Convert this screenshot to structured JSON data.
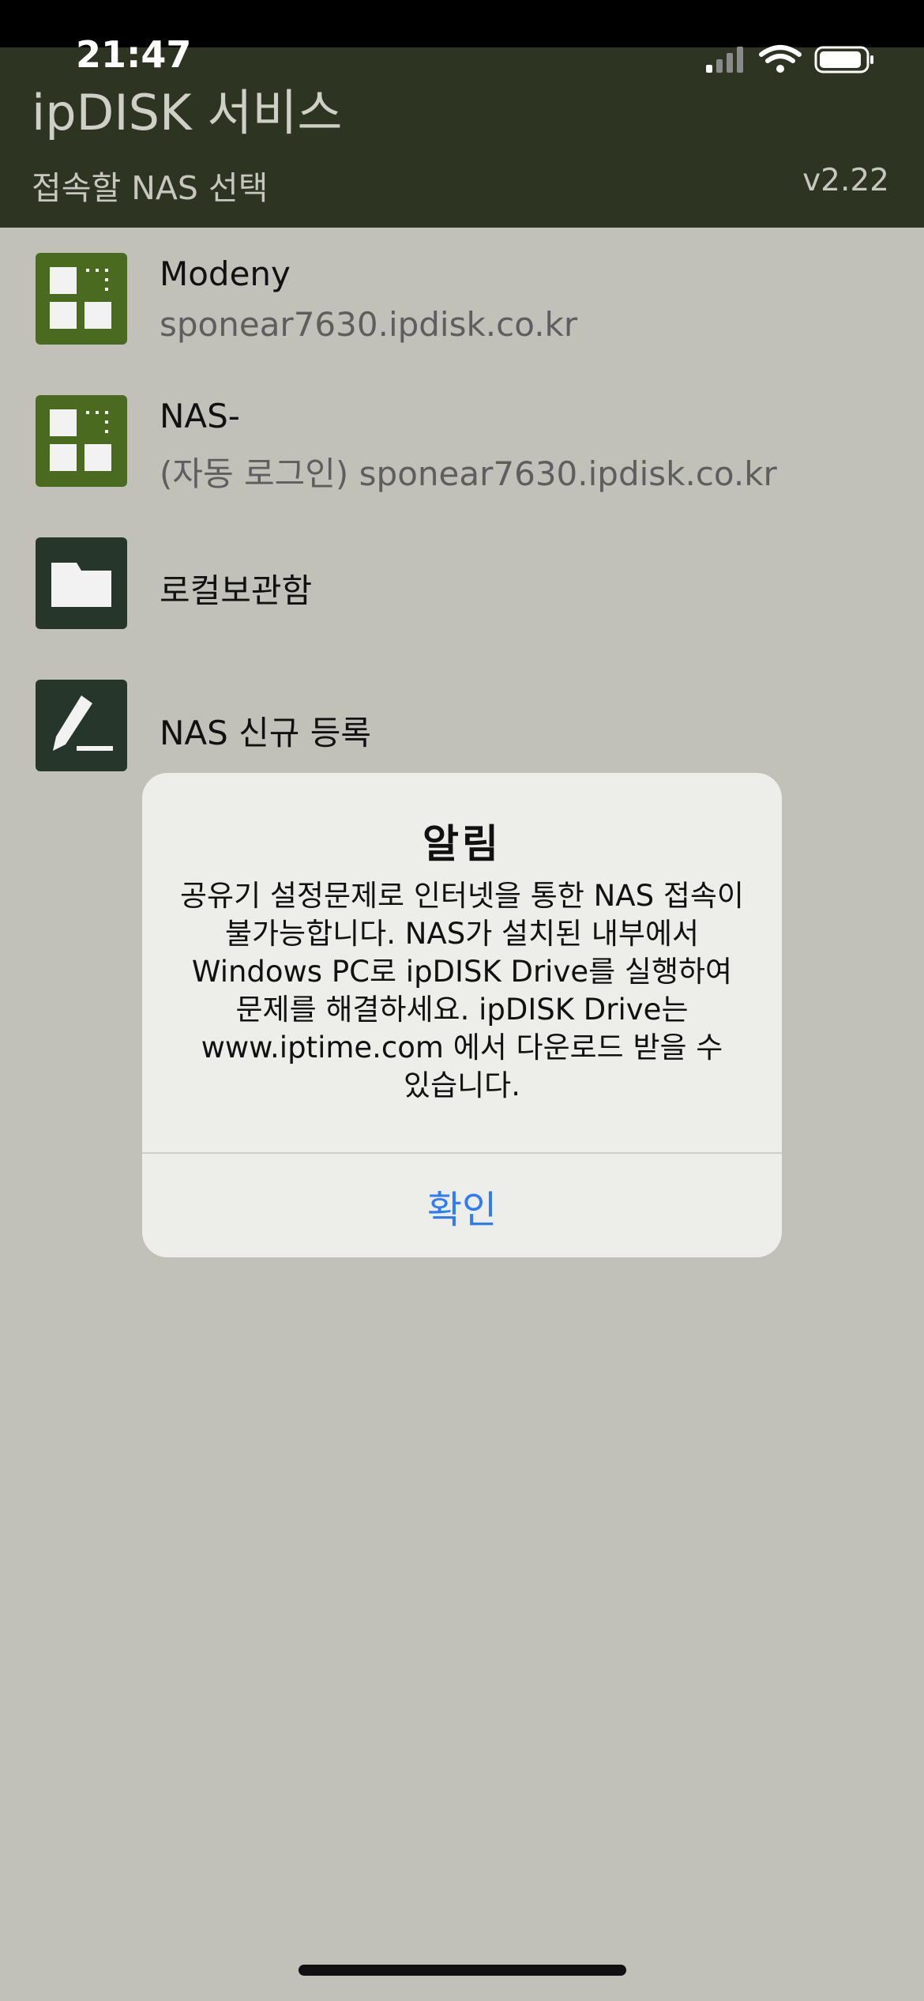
{
  "status_bar": {
    "time": "21:47"
  },
  "header": {
    "title": "ipDISK 서비스",
    "subtitle": "접속할 NAS 선택",
    "version": "v2.22"
  },
  "list": [
    {
      "name": "Modeny",
      "detail": "sponear7630.ipdisk.co.kr",
      "icon": "nas-grid-icon"
    },
    {
      "name": "NAS-",
      "detail": "(자동 로그인) sponear7630.ipdisk.co.kr",
      "icon": "nas-grid-icon"
    },
    {
      "name": "로컬보관함",
      "icon": "folder-icon"
    },
    {
      "name": "NAS 신규 등록",
      "icon": "pen-icon"
    }
  ],
  "alert": {
    "title": "알림",
    "lines": [
      "공유기 설정문제로 인터넷을 통한 NAS 접속이",
      "불가능합니다. NAS가 설치된 내부에서",
      "Windows PC로 ipDISK Drive를 실행하여",
      "문제를 해결하세요. ipDISK Drive는",
      "www.iptime.com 에서 다운로드 받을 수",
      "있습니다."
    ],
    "confirm": "확인"
  },
  "colors": {
    "header_bg": "#2d3422",
    "backdrop": "#c1c1b9",
    "accent": "#2e7cf6",
    "icon_green": "#4a6a1f",
    "icon_dark": "#26362b"
  }
}
